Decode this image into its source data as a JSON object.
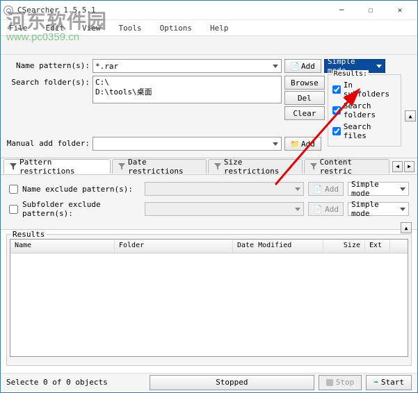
{
  "window": {
    "title": "CSearcher 1.5.5.1"
  },
  "menu": {
    "file": "File",
    "edit": "Edit",
    "view": "View",
    "tools": "Tools",
    "options": "Options",
    "help": "Help"
  },
  "watermark": {
    "line1": "河东软件园",
    "line2": "www.pc0359.cn"
  },
  "labels": {
    "name_pattern": "Name pattern(s):",
    "search_folder": "Search folder(s):",
    "manual_add": "Manual add folder:"
  },
  "values": {
    "pattern": "*.rar",
    "folders": [
      "C:\\",
      "D:\\tools\\桌面"
    ],
    "manual": ""
  },
  "buttons": {
    "add": "Add",
    "browse": "Browse",
    "del": "Del",
    "clear": "Clear",
    "stopped": "Stopped",
    "stop": "Stop",
    "start": "Start"
  },
  "mode": {
    "selected": "Simple mode",
    "option": "Simple mode"
  },
  "results_group": {
    "legend": "Results:",
    "in_subfolders": "In subfolders",
    "search_folders": "Search folders",
    "search_files": "Search files",
    "chk1": true,
    "chk2": true,
    "chk3": true
  },
  "tabs": {
    "pattern": "Pattern restrictions",
    "date": "Date restrictions",
    "size": "Size restrictions",
    "content": "Content restric"
  },
  "exclude": {
    "name": "Name exclude pattern(s):",
    "subfolder": "Subfolder exclude pattern(s):",
    "add": "Add"
  },
  "results": {
    "legend": "Results",
    "cols": {
      "name": "Name",
      "folder": "Folder",
      "date": "Date Modified",
      "size": "Size",
      "ext": "Ext"
    }
  },
  "status": {
    "text": "Selecte 0 of 0 objects"
  }
}
